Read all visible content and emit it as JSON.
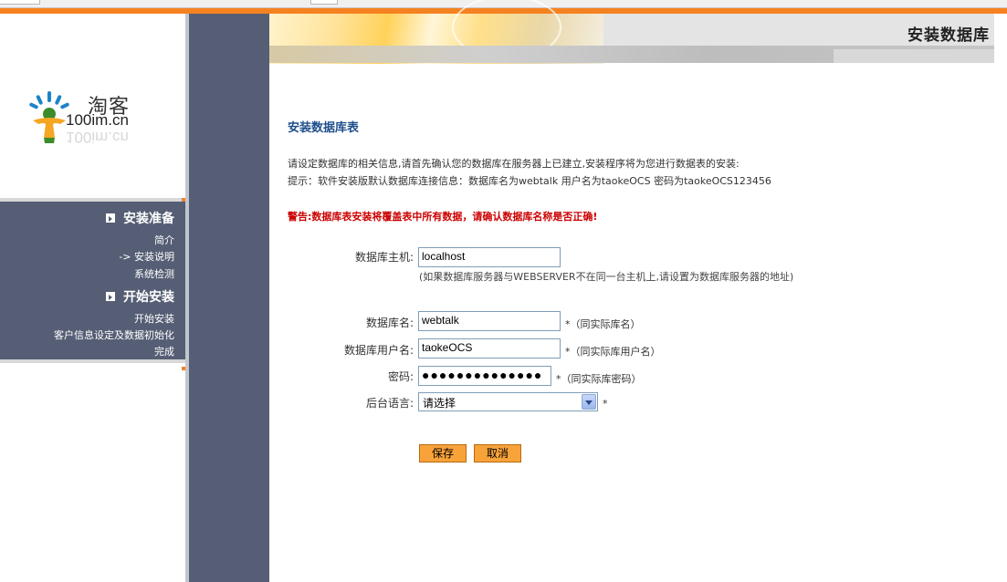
{
  "header": {
    "title": "安装数据库"
  },
  "logo": {
    "brand": "淘客",
    "url": "100im.cn"
  },
  "sidebar": {
    "sections": [
      {
        "label": "安装准备",
        "items": [
          "简介",
          "-> 安装说明",
          "系统检测"
        ]
      },
      {
        "label": "开始安装",
        "items": [
          "开始安装",
          "客户信息设定及数据初始化",
          "完成"
        ]
      }
    ]
  },
  "main": {
    "section_title": "安装数据库表",
    "intro_line1": "请设定数据库的相关信息,请首先确认您的数据库在服务器上已建立,安装程序将为您进行数据表的安装:",
    "intro_line2": "提示：软件安装版默认数据库连接信息：数据库名为webtalk 用户名为taokeOCS 密码为taokeOCS123456",
    "warning": "警告:数据库表安装将覆盖表中所有数据，请确认数据库名称是否正确!"
  },
  "form": {
    "host": {
      "label": "数据库主机:",
      "value": "localhost",
      "note": "(如果数据库服务器与WEBSERVER不在同一台主机上,请设置为数据库服务器的地址)"
    },
    "dbname": {
      "label": "数据库名:",
      "value": "webtalk",
      "hint": "*（同实际库名）"
    },
    "dbuser": {
      "label": "数据库用户名:",
      "value": "taokeOCS",
      "hint": "*（同实际库用户名）"
    },
    "password": {
      "label": "密码:",
      "value": "taokeOCS123456",
      "hint": "*（同实际库密码）"
    },
    "language": {
      "label": "后台语言:",
      "selected": "请选择",
      "hint": "*"
    },
    "save_label": "保存",
    "cancel_label": "取消"
  }
}
